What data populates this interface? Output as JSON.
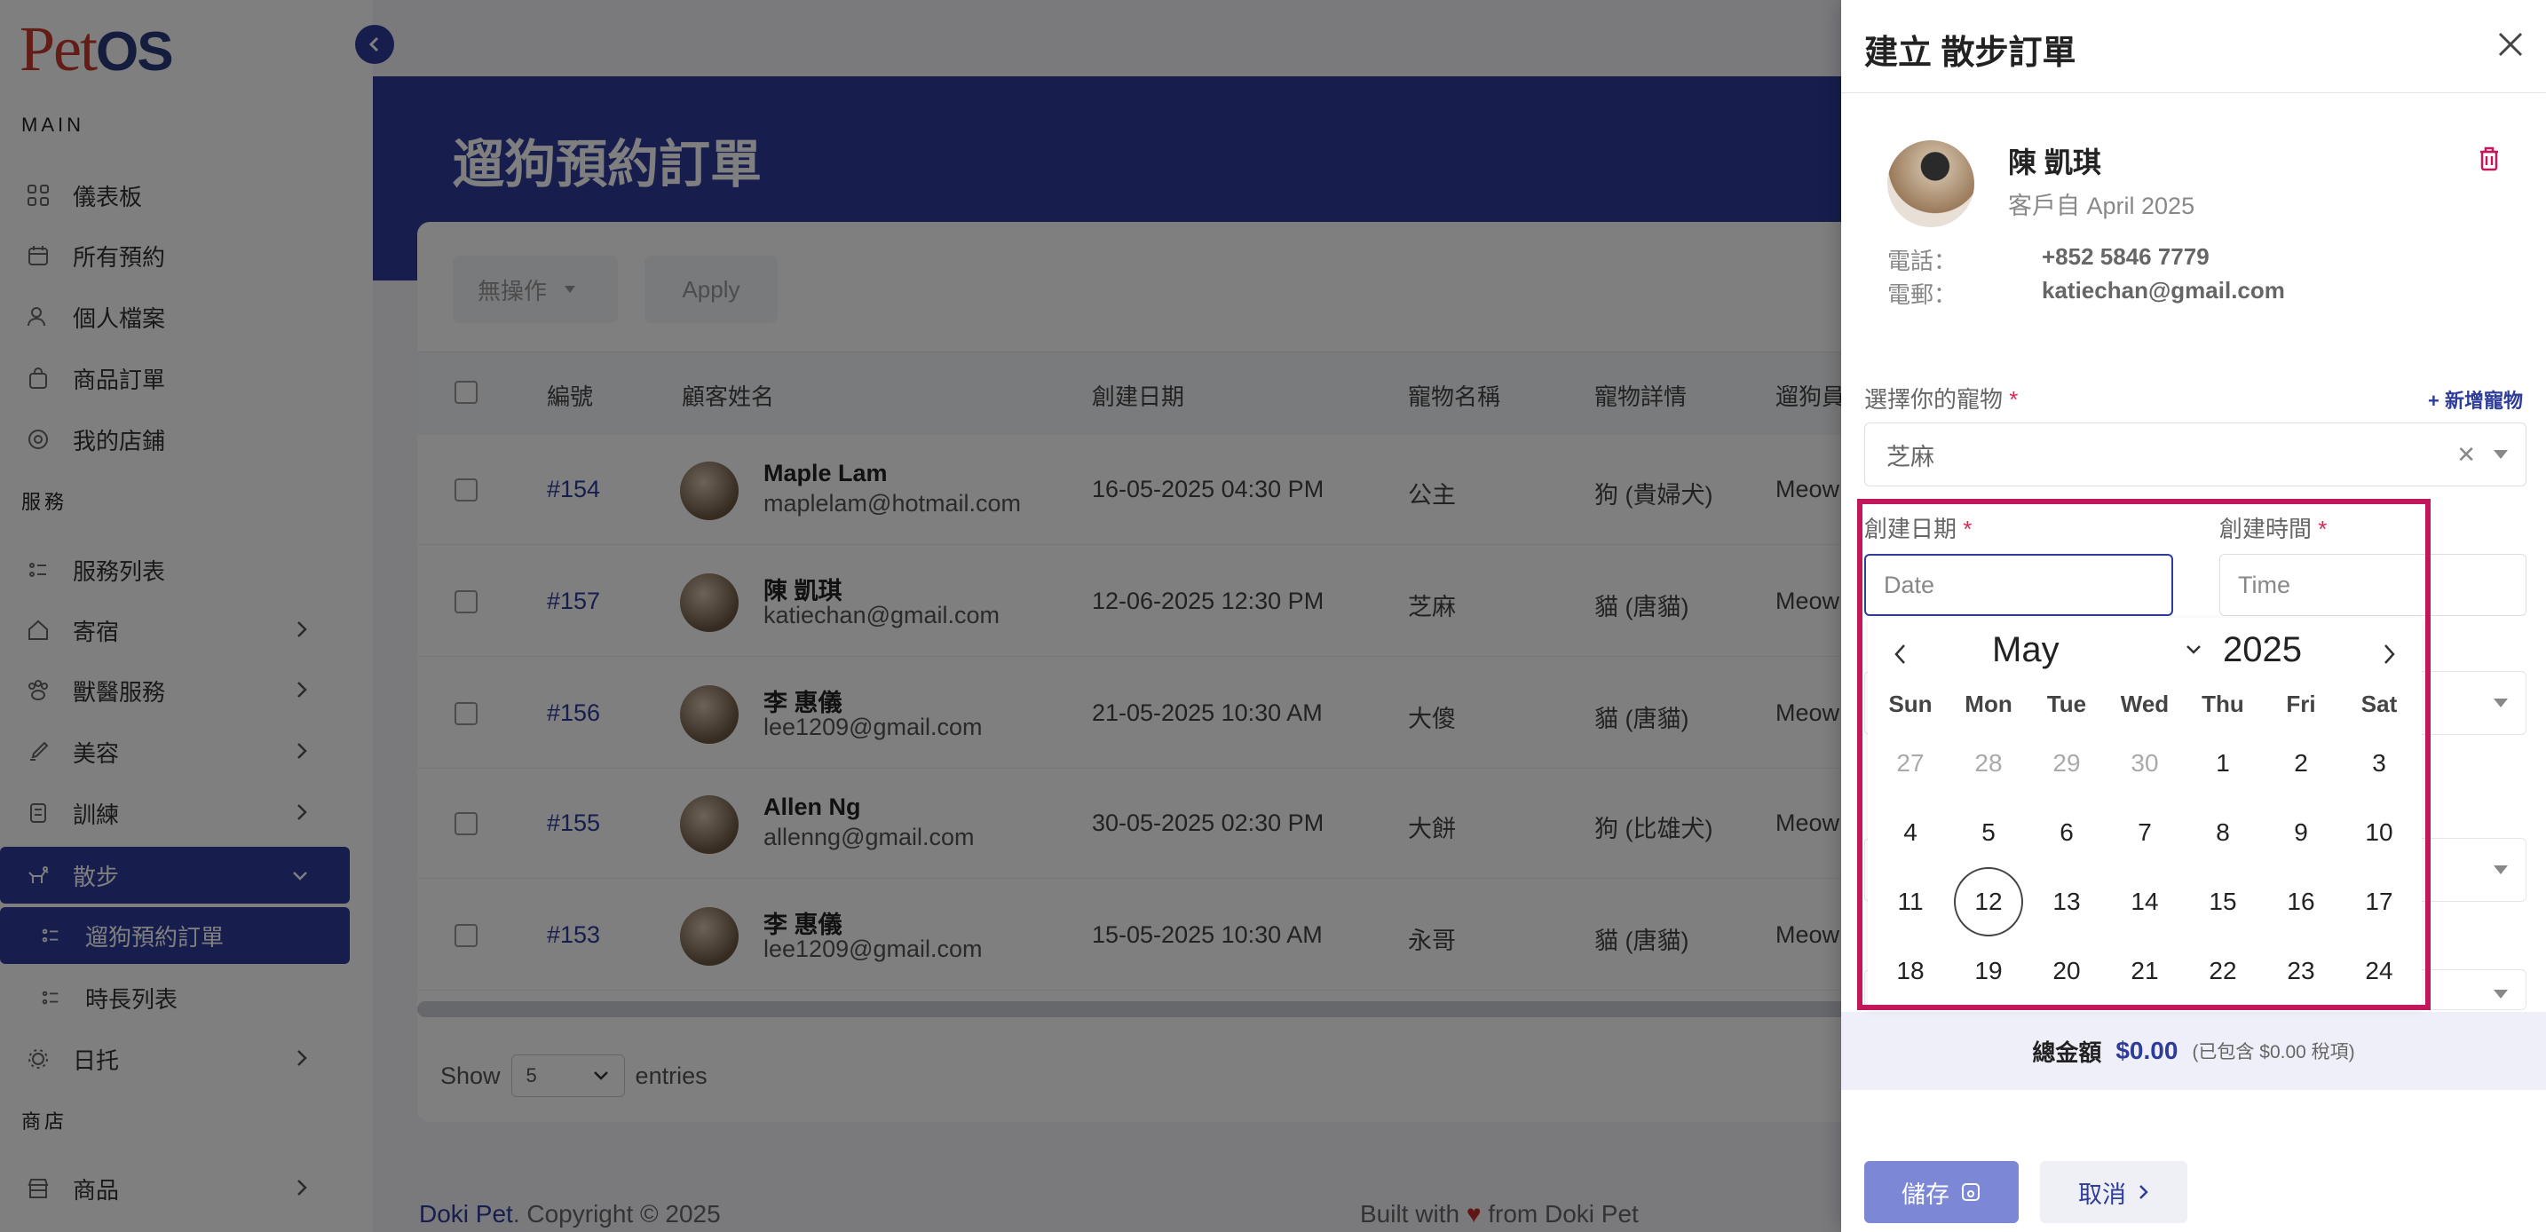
{
  "sidebar": {
    "logo_prefix": "Pet",
    "logo_suffix": "OS",
    "section_main": "MAIN",
    "section_services": "服務",
    "section_shop": "商店",
    "items": {
      "dashboard": "儀表板",
      "all_bookings": "所有預約",
      "profile": "個人檔案",
      "product_orders": "商品訂單",
      "my_store": "我的店鋪",
      "service_list": "服務列表",
      "boarding": "寄宿",
      "vet": "獸醫服務",
      "grooming": "美容",
      "training": "訓練",
      "walking": "散步",
      "walking_orders": "遛狗預約訂單",
      "duration_list": "時長列表",
      "daycare": "日托",
      "products": "商品"
    }
  },
  "page": {
    "title": "遛狗預約訂單",
    "bulk_action": "無操作",
    "apply": "Apply"
  },
  "table": {
    "headers": [
      "編號",
      "顧客姓名",
      "創建日期",
      "寵物名稱",
      "寵物詳情",
      "遛狗員"
    ],
    "rows": [
      {
        "id": "#154",
        "name": "Maple Lam",
        "email": "maplelam@hotmail.com",
        "date": "16-05-2025 04:30 PM",
        "pet": "公主",
        "detail": "狗 (貴婦犬)",
        "walker": "Meow"
      },
      {
        "id": "#157",
        "name": "陳 凱琪",
        "email": "katiechan@gmail.com",
        "date": "12-06-2025 12:30 PM",
        "pet": "芝麻",
        "detail": "貓 (唐貓)",
        "walker": "Meow"
      },
      {
        "id": "#156",
        "name": "李 惠儀",
        "email": "lee1209@gmail.com",
        "date": "21-05-2025 10:30 AM",
        "pet": "大傻",
        "detail": "貓 (唐貓)",
        "walker": "Meow"
      },
      {
        "id": "#155",
        "name": "Allen Ng",
        "email": "allenng@gmail.com",
        "date": "30-05-2025 02:30 PM",
        "pet": "大餅",
        "detail": "狗 (比雄犬)",
        "walker": "Meow"
      },
      {
        "id": "#153",
        "name": "李 惠儀",
        "email": "lee1209@gmail.com",
        "date": "15-05-2025 10:30 AM",
        "pet": "永哥",
        "detail": "貓 (唐貓)",
        "walker": "Meow"
      }
    ],
    "show_label": "Show",
    "show_value": "5",
    "entries_label": "entries"
  },
  "footer": {
    "brand": "Doki Pet",
    "copyright": ". Copyright © 2025",
    "built_prefix": "Built with",
    "built_suffix": "from Doki Pet"
  },
  "panel": {
    "title": "建立 散步訂單",
    "customer": {
      "name": "陳 凱琪",
      "since": "客戶自 April 2025",
      "phone_label": "電話：",
      "phone": "+852 5846 7779",
      "email_label": "電郵：",
      "email": "katiechan@gmail.com"
    },
    "pet_label": "選擇你的寵物",
    "required_mark": "*",
    "add_pet": "+ 新增寵物",
    "pet_value": "芝麻",
    "date_label": "創建日期",
    "time_label": "創建時間",
    "date_placeholder": "Date",
    "time_placeholder": "Time",
    "calendar": {
      "month": "May",
      "year": "2025",
      "weekdays": [
        "Sun",
        "Mon",
        "Tue",
        "Wed",
        "Thu",
        "Fri",
        "Sat"
      ],
      "weeks": [
        [
          "27",
          "28",
          "29",
          "30",
          "1",
          "2",
          "3"
        ],
        [
          "4",
          "5",
          "6",
          "7",
          "8",
          "9",
          "10"
        ],
        [
          "11",
          "12",
          "13",
          "14",
          "15",
          "16",
          "17"
        ],
        [
          "18",
          "19",
          "20",
          "21",
          "22",
          "23",
          "24"
        ]
      ],
      "muted_first_row_count": 4,
      "today": "12"
    },
    "total_label": "總金額",
    "total_value": "$0.00",
    "tax_note": "(已包含 $0.00 稅項)",
    "save": "儲存",
    "cancel": "取消"
  },
  "colors": {
    "primary": "#2e3c9a",
    "highlight": "#c2185b",
    "logo_red": "#c63a2f"
  }
}
